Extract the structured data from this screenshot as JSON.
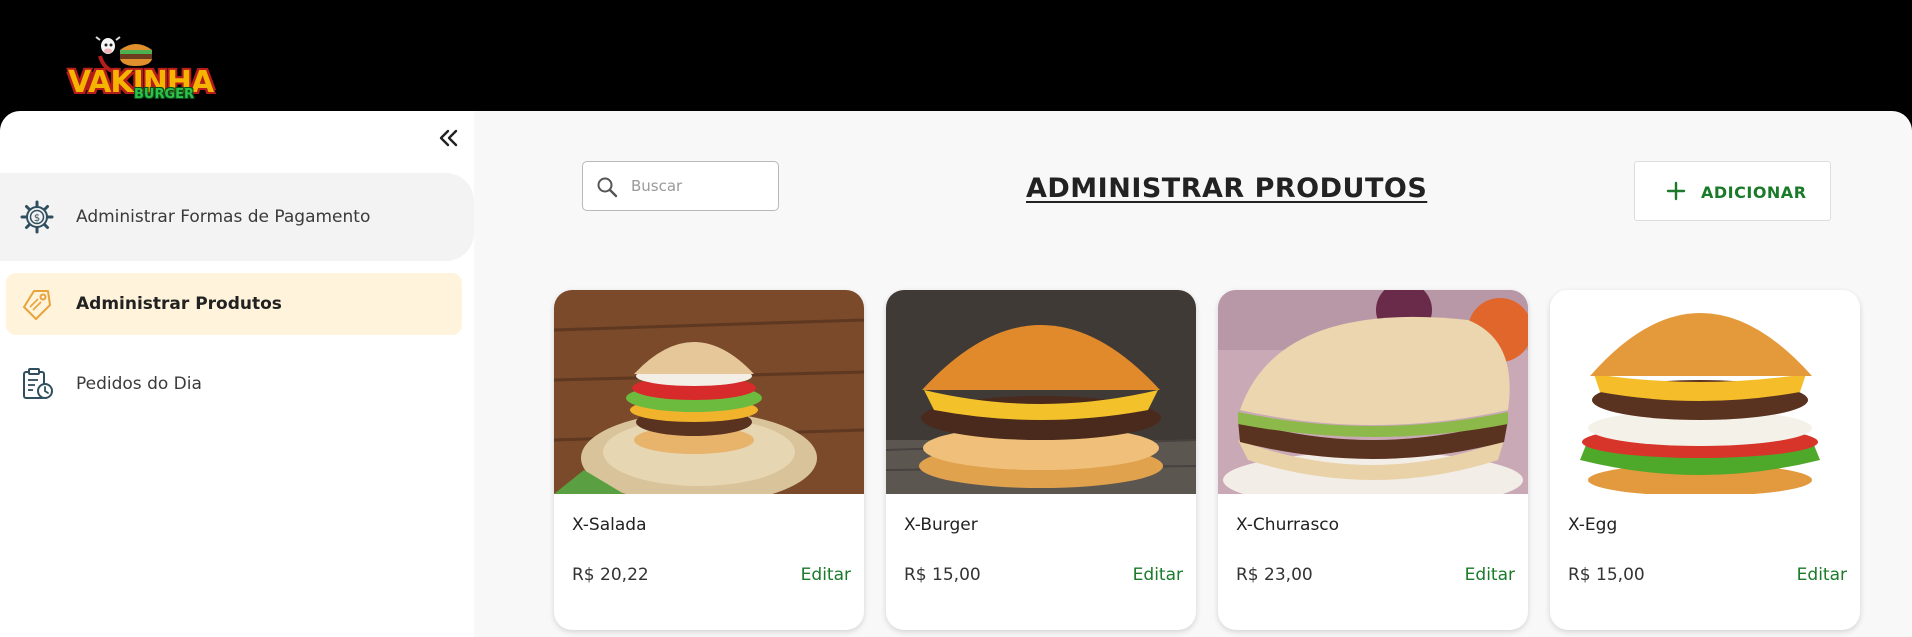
{
  "brand": {
    "name": "VAKINHA",
    "sub": "BURGER"
  },
  "sidebar": {
    "items": [
      {
        "label": "Administrar Formas de Pagamento",
        "icon": "payment-gear-icon"
      },
      {
        "label": "Administrar Produtos",
        "icon": "product-tag-icon",
        "active": true
      },
      {
        "label": "Pedidos do Dia",
        "icon": "orders-clipboard-icon"
      }
    ]
  },
  "search": {
    "placeholder": "Buscar"
  },
  "page": {
    "title": "ADMINISTRAR PRODUTOS"
  },
  "actions": {
    "add_label": "ADICIONAR"
  },
  "products": [
    {
      "name": "X-Salada",
      "price": "R$ 20,22",
      "edit_label": "Editar"
    },
    {
      "name": "X-Burger",
      "price": "R$ 15,00",
      "edit_label": "Editar"
    },
    {
      "name": "X-Churrasco",
      "price": "R$ 23,00",
      "edit_label": "Editar"
    },
    {
      "name": "X-Egg",
      "price": "R$ 15,00",
      "edit_label": "Editar"
    }
  ],
  "colors": {
    "accent": "#1a7a2a",
    "active_bg": "#fff3db",
    "header_bg": "#000000"
  }
}
